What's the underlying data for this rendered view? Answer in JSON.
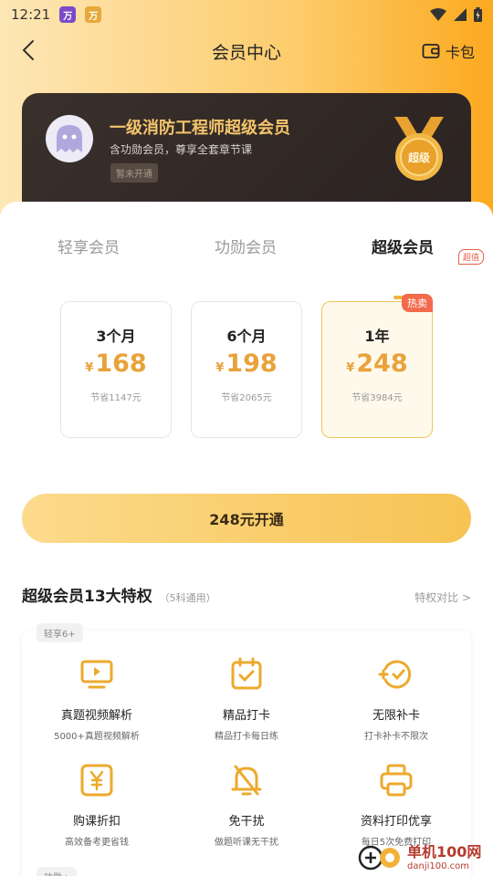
{
  "status_bar": {
    "time": "12:21"
  },
  "nav": {
    "title": "会员中心",
    "wallet_label": "卡包"
  },
  "member_card": {
    "title": "一级消防工程师超级会员",
    "subtitle": "含功勋会员，尊享全套章节课",
    "status": "暂未开通",
    "medal_label": "超级"
  },
  "tabs": [
    {
      "label": "轻享会员"
    },
    {
      "label": "功勋会员"
    },
    {
      "label": "超级会员"
    }
  ],
  "tab_badge": "超值",
  "plans": [
    {
      "duration": "3个月",
      "currency": "¥",
      "price": "168",
      "saving": "节省1147元"
    },
    {
      "duration": "6个月",
      "currency": "¥",
      "price": "198",
      "saving": "节省2065元"
    },
    {
      "duration": "1年",
      "currency": "¥",
      "price": "248",
      "saving": "节省3984元",
      "tag": "热卖"
    }
  ],
  "cta_label": "248元开通",
  "benefits_section": {
    "title": "超级会员13大特权",
    "note": "（5科通用）",
    "link": "特权对比 >",
    "group_tag": "轻享6+",
    "group_tag2": "功勋+",
    "items": [
      {
        "icon": "video-play-icon",
        "title": "真题视频解析",
        "desc": "5000+真题视频解析"
      },
      {
        "icon": "calendar-check-icon",
        "title": "精品打卡",
        "desc": "精品打卡每日练"
      },
      {
        "icon": "refresh-check-icon",
        "title": "无限补卡",
        "desc": "打卡补卡不限次"
      },
      {
        "icon": "yen-coupon-icon",
        "title": "购课折扣",
        "desc": "高效备考更省钱"
      },
      {
        "icon": "bell-mute-icon",
        "title": "免干扰",
        "desc": "做题听课无干扰"
      },
      {
        "icon": "printer-icon",
        "title": "资料打印优享",
        "desc": "每日5次免费打印"
      }
    ]
  },
  "watermark": {
    "main": "单机100网",
    "sub": "danji100.com"
  },
  "colors": {
    "accent": "#f1b441",
    "price": "#e9a23a",
    "hot": "#f46a4c",
    "card_dark": "#2b2321"
  }
}
